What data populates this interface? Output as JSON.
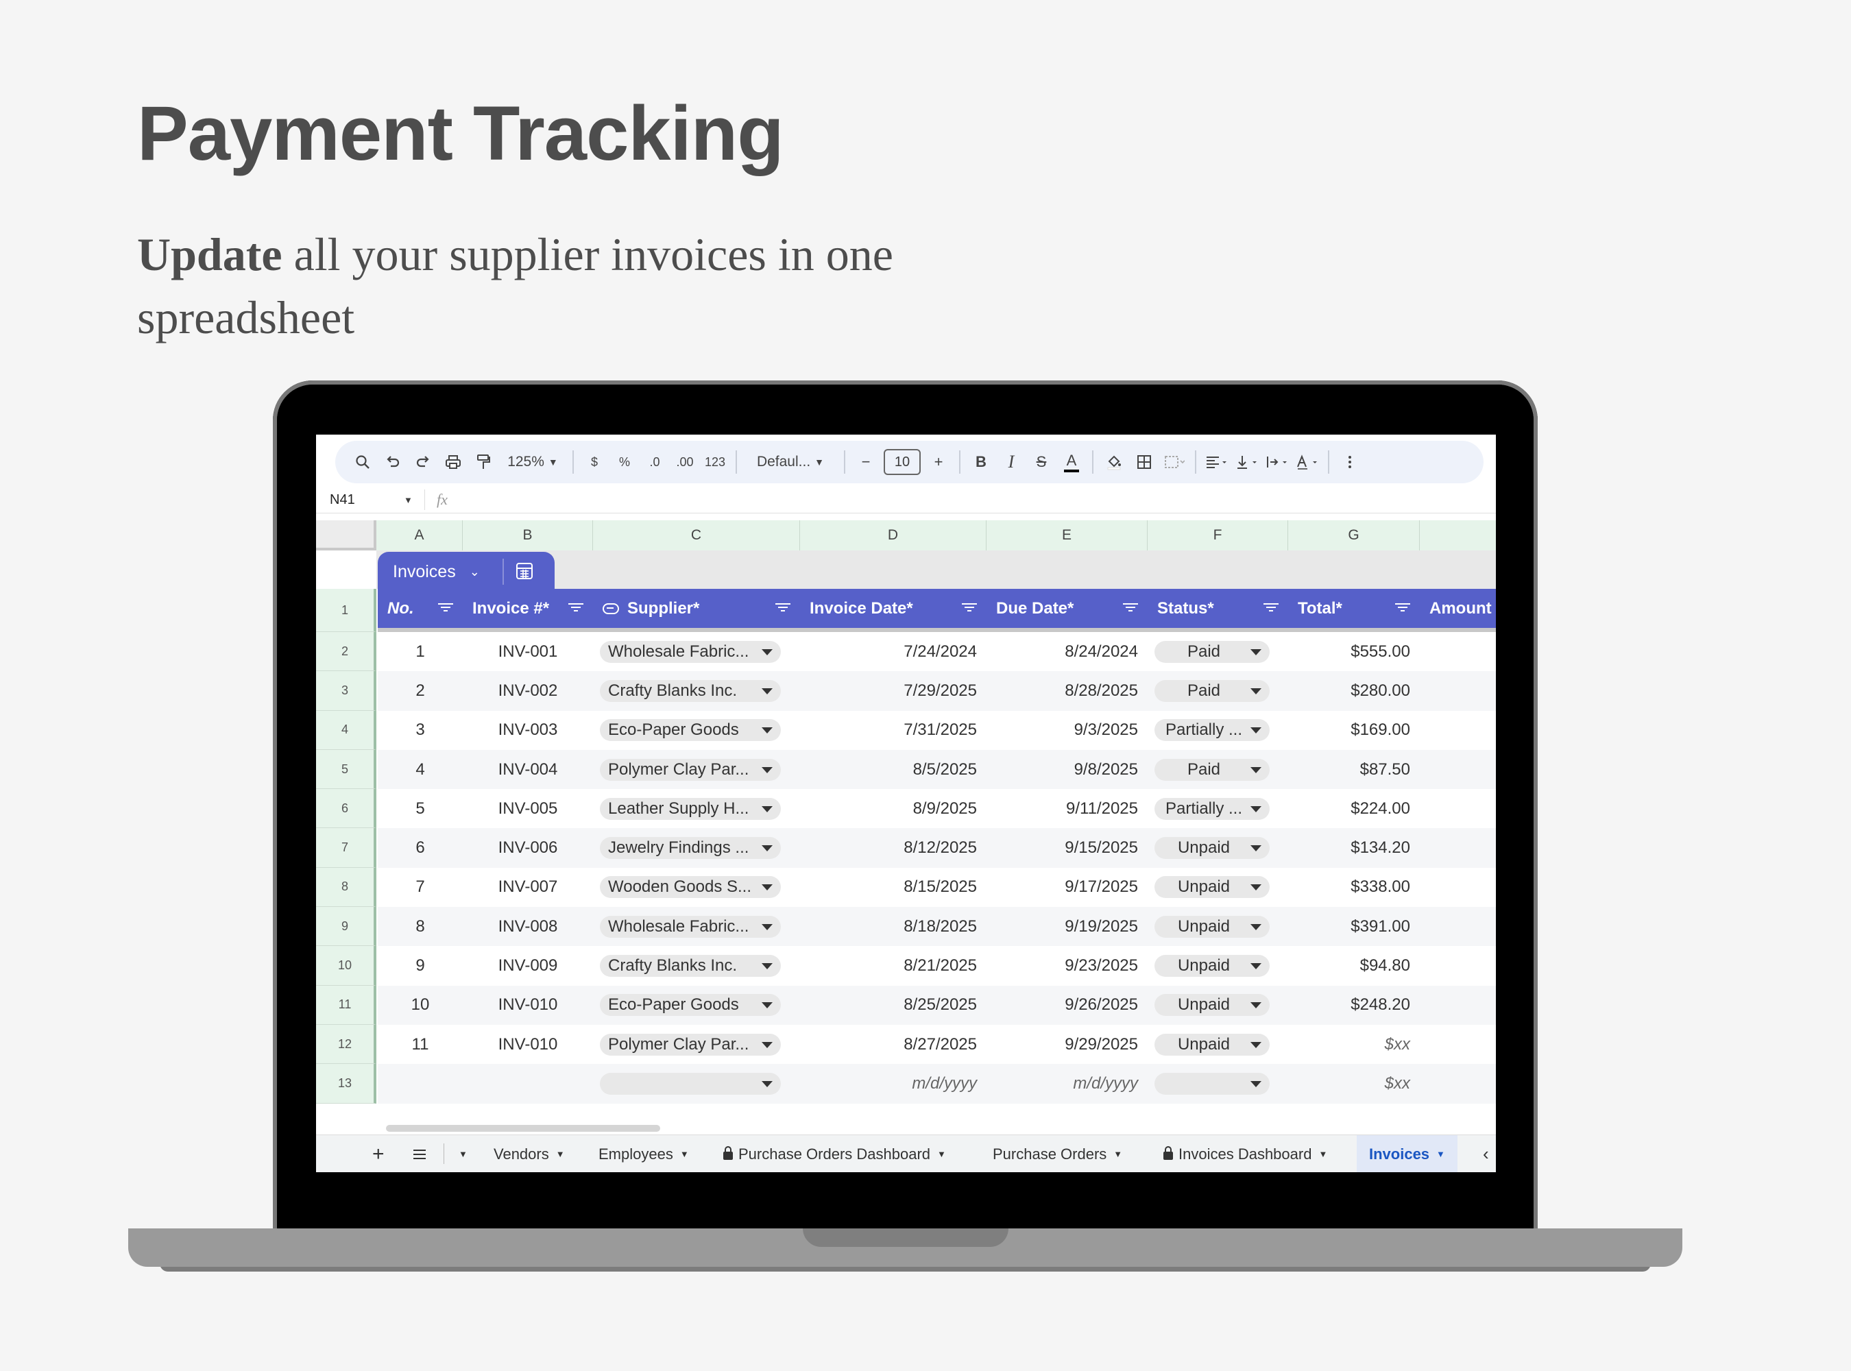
{
  "page": {
    "title": "Payment Tracking",
    "subtitle_bold": "Update",
    "subtitle_rest": " all your supplier invoices in one spreadsheet"
  },
  "toolbar": {
    "zoom": "125%",
    "currency": "$",
    "percent": "%",
    "decrease_decimal": ".0",
    "increase_decimal": ".00",
    "number_format": "123",
    "font": "Defaul...",
    "font_size": "10",
    "bold": "B",
    "italic": "I",
    "text_color": "A"
  },
  "formula_bar": {
    "cell_ref": "N41",
    "fx": "fx"
  },
  "columns": [
    "A",
    "B",
    "C",
    "D",
    "E",
    "F",
    "G"
  ],
  "table": {
    "name": "Invoices",
    "headers": [
      "No.",
      "Invoice #*",
      "Supplier*",
      "Invoice Date*",
      "Due Date*",
      "Status*",
      "Total*",
      "Amount"
    ],
    "rows": [
      {
        "row": "2",
        "no": "1",
        "inv": "INV-001",
        "supplier": "Wholesale Fabric...",
        "idate": "7/24/2024",
        "ddate": "8/24/2024",
        "status": "Paid",
        "total": "$555.00"
      },
      {
        "row": "3",
        "no": "2",
        "inv": "INV-002",
        "supplier": "Crafty Blanks Inc.",
        "idate": "7/29/2025",
        "ddate": "8/28/2025",
        "status": "Paid",
        "total": "$280.00"
      },
      {
        "row": "4",
        "no": "3",
        "inv": "INV-003",
        "supplier": "Eco-Paper Goods",
        "idate": "7/31/2025",
        "ddate": "9/3/2025",
        "status": "Partially ...",
        "total": "$169.00"
      },
      {
        "row": "5",
        "no": "4",
        "inv": "INV-004",
        "supplier": "Polymer Clay Par...",
        "idate": "8/5/2025",
        "ddate": "9/8/2025",
        "status": "Paid",
        "total": "$87.50"
      },
      {
        "row": "6",
        "no": "5",
        "inv": "INV-005",
        "supplier": "Leather Supply H...",
        "idate": "8/9/2025",
        "ddate": "9/11/2025",
        "status": "Partially ...",
        "total": "$224.00"
      },
      {
        "row": "7",
        "no": "6",
        "inv": "INV-006",
        "supplier": "Jewelry Findings ...",
        "idate": "8/12/2025",
        "ddate": "9/15/2025",
        "status": "Unpaid",
        "total": "$134.20"
      },
      {
        "row": "8",
        "no": "7",
        "inv": "INV-007",
        "supplier": "Wooden Goods S...",
        "idate": "8/15/2025",
        "ddate": "9/17/2025",
        "status": "Unpaid",
        "total": "$338.00"
      },
      {
        "row": "9",
        "no": "8",
        "inv": "INV-008",
        "supplier": "Wholesale Fabric...",
        "idate": "8/18/2025",
        "ddate": "9/19/2025",
        "status": "Unpaid",
        "total": "$391.00"
      },
      {
        "row": "10",
        "no": "9",
        "inv": "INV-009",
        "supplier": "Crafty Blanks Inc.",
        "idate": "8/21/2025",
        "ddate": "9/23/2025",
        "status": "Unpaid",
        "total": "$94.80"
      },
      {
        "row": "11",
        "no": "10",
        "inv": "INV-010",
        "supplier": "Eco-Paper Goods",
        "idate": "8/25/2025",
        "ddate": "9/26/2025",
        "status": "Unpaid",
        "total": "$248.20"
      },
      {
        "row": "12",
        "no": "11",
        "inv": "INV-010",
        "supplier": "Polymer Clay Par...",
        "idate": "8/27/2025",
        "ddate": "9/29/2025",
        "status": "Unpaid",
        "total": "$xx"
      },
      {
        "row": "13",
        "no": "",
        "inv": "",
        "supplier": "",
        "idate": "m/d/yyyy",
        "ddate": "m/d/yyyy",
        "status": "",
        "total": "$xx"
      }
    ]
  },
  "sheet_tabs": [
    "Vendors",
    "Employees",
    "Purchase Orders Dashboard",
    "Purchase Orders",
    "Invoices Dashboard",
    "Invoices"
  ],
  "colors": {
    "background": "#f5f5f5",
    "table_header": "#5660c9",
    "row_header": "#e6f4ea",
    "active_tab": "#1a56c2"
  }
}
